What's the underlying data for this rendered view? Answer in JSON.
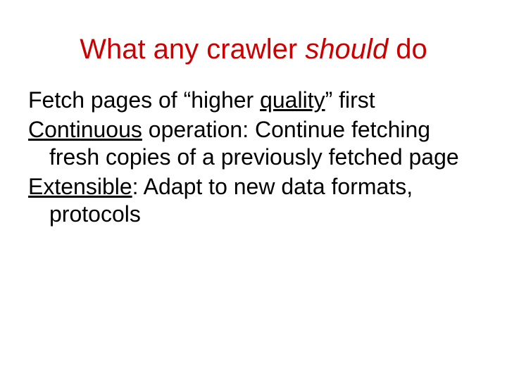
{
  "title": {
    "part1": "What any crawler ",
    "italic": "should",
    "part2": " do"
  },
  "bullets": {
    "b1": {
      "pre": "Fetch pages of “higher ",
      "underlined": "quality",
      "post": "” first"
    },
    "b2": {
      "underlined": "Continuous",
      "post": " operation: Continue fetching fresh copies of a previously fetched page"
    },
    "b3": {
      "underlined": "Extensible",
      "post": ": Adapt to new data formats, protocols"
    }
  }
}
